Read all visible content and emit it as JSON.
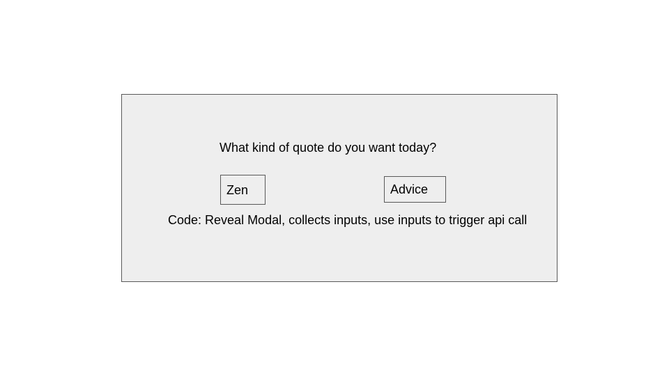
{
  "modal": {
    "question": "What kind of quote do you want today?",
    "choices": [
      {
        "label": "Zen"
      },
      {
        "label": "Advice"
      }
    ],
    "note": "Code: Reveal Modal, collects inputs, use inputs to trigger api call"
  },
  "colors": {
    "modal_background": "#eeeeee",
    "border": "#595959",
    "page_background": "#ffffff",
    "text": "#000000"
  }
}
